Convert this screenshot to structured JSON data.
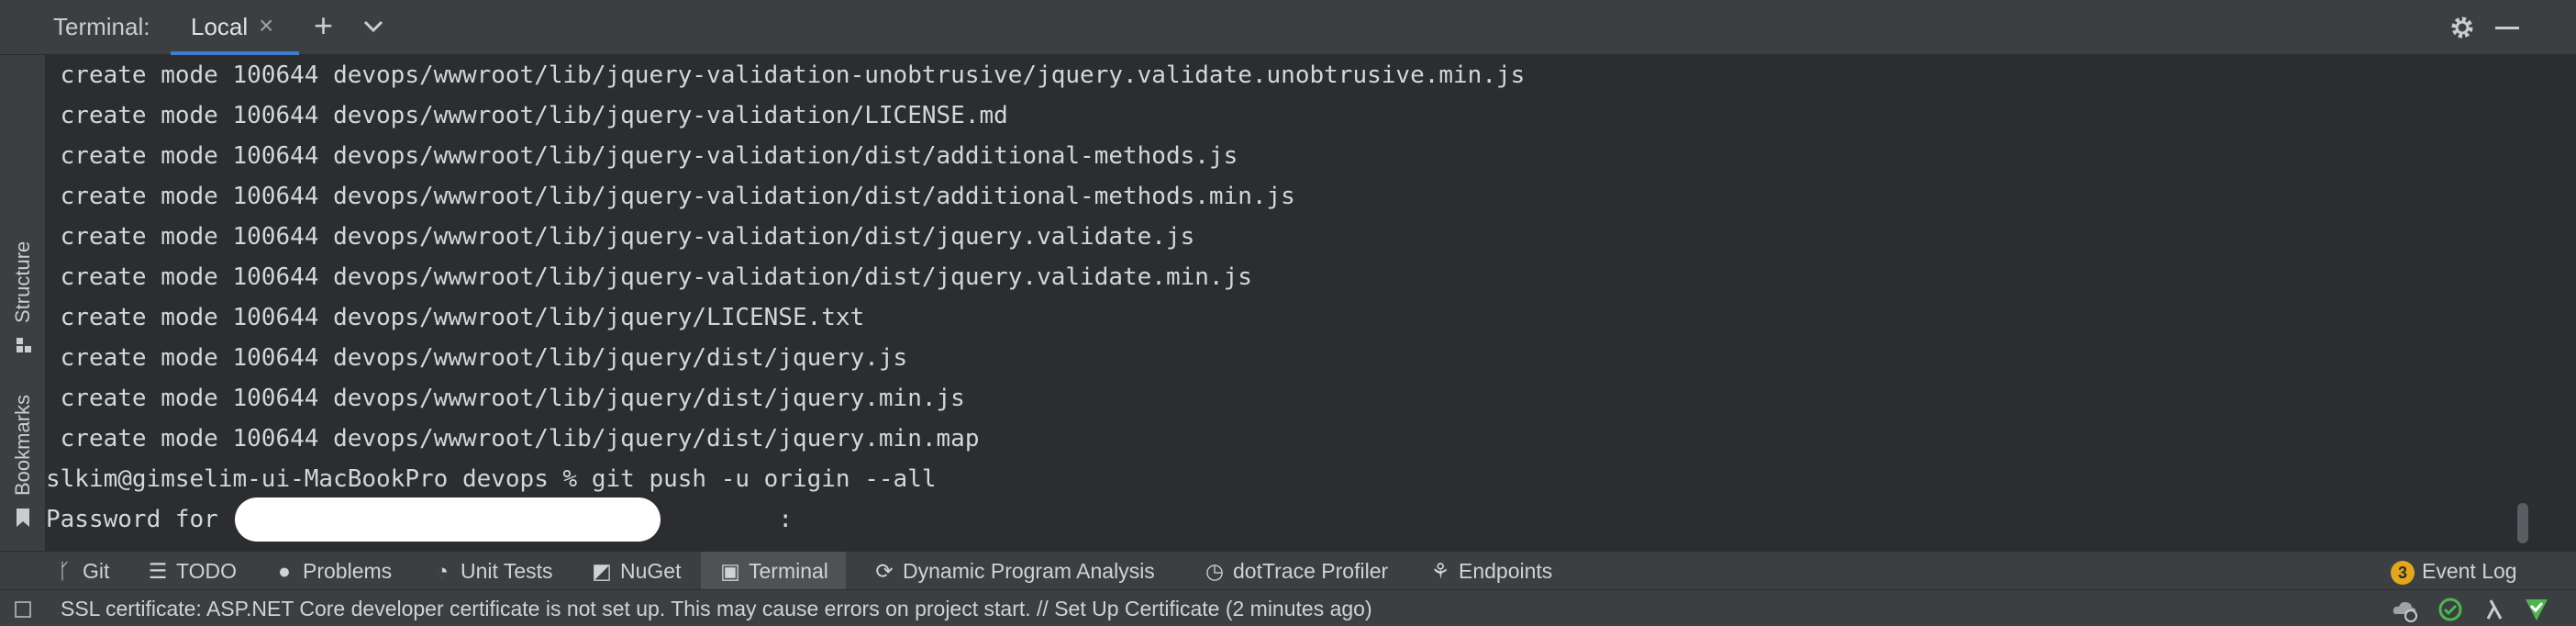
{
  "window": {
    "title": "Terminal:",
    "tab_label": "Local",
    "tab_close": "×",
    "add_label": "+"
  },
  "sidebar": {
    "structure_label": "Structure",
    "bookmarks_label": "Bookmarks"
  },
  "terminal": {
    "lines": [
      " create mode 100644 devops/wwwroot/lib/jquery-validation-unobtrusive/jquery.validate.unobtrusive.min.js",
      " create mode 100644 devops/wwwroot/lib/jquery-validation/LICENSE.md",
      " create mode 100644 devops/wwwroot/lib/jquery-validation/dist/additional-methods.js",
      " create mode 100644 devops/wwwroot/lib/jquery-validation/dist/additional-methods.min.js",
      " create mode 100644 devops/wwwroot/lib/jquery-validation/dist/jquery.validate.js",
      " create mode 100644 devops/wwwroot/lib/jquery-validation/dist/jquery.validate.min.js",
      " create mode 100644 devops/wwwroot/lib/jquery/LICENSE.txt",
      " create mode 100644 devops/wwwroot/lib/jquery/dist/jquery.js",
      " create mode 100644 devops/wwwroot/lib/jquery/dist/jquery.min.js",
      " create mode 100644 devops/wwwroot/lib/jquery/dist/jquery.min.map",
      "slkim@gimselim-ui-MacBookPro devops % git push -u origin --all",
      "Password for                                       :"
    ]
  },
  "toolbar": {
    "items": [
      {
        "label": "Git",
        "icon": "git-branch-icon"
      },
      {
        "label": "TODO",
        "icon": "list-icon"
      },
      {
        "label": "Problems",
        "icon": "problems-icon"
      },
      {
        "label": "Unit Tests",
        "icon": "unit-tests-icon"
      },
      {
        "label": "NuGet",
        "icon": "nuget-icon"
      },
      {
        "label": "Terminal",
        "icon": "terminal-icon"
      },
      {
        "label": "Dynamic Program Analysis",
        "icon": "analysis-icon"
      },
      {
        "label": "dotTrace Profiler",
        "icon": "profiler-icon"
      },
      {
        "label": "Endpoints",
        "icon": "endpoints-icon"
      }
    ],
    "event_log_label": "Event Log",
    "event_log_count": "3"
  },
  "status": {
    "message": "SSL certificate: ASP.NET Core developer certificate is not set up. This may cause errors on project start. // Set Up Certificate (2 minutes ago)"
  },
  "colors": {
    "accent": "#3d7ccf",
    "badge": "#e0a71f",
    "ok_green": "#4fb64f"
  }
}
